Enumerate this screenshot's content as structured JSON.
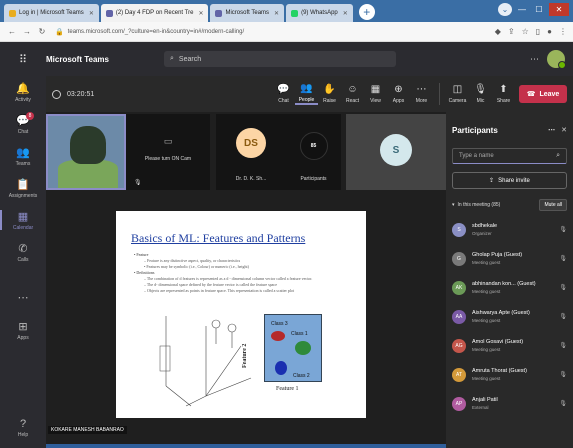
{
  "browser": {
    "tabs": [
      {
        "title": "Log in | Microsoft Teams",
        "color": "#e8ad20",
        "active": false
      },
      {
        "title": "(2) Day 4 FDP on Recent Tre",
        "color": "#6264a7",
        "active": true
      },
      {
        "title": "Microsoft Teams",
        "color": "#6264a7",
        "active": false
      },
      {
        "title": "(9) WhatsApp",
        "color": "#25d366",
        "active": false
      }
    ],
    "url": "teams.microsoft.com/_?culture=en-in&country=in#/modern-calling/"
  },
  "teams": {
    "app_name": "Microsoft Teams",
    "search_placeholder": "Search"
  },
  "rail": [
    {
      "label": "Activity",
      "icon": "bell-icon",
      "glyph": "🔔"
    },
    {
      "label": "Chat",
      "icon": "chat-icon",
      "glyph": "💬",
      "badge": "8"
    },
    {
      "label": "Teams",
      "icon": "teams-icon",
      "glyph": "👥"
    },
    {
      "label": "Assignments",
      "icon": "assignments-icon",
      "glyph": "📋"
    },
    {
      "label": "Calendar",
      "icon": "calendar-icon",
      "glyph": "▦",
      "active": true
    },
    {
      "label": "Calls",
      "icon": "phone-icon",
      "glyph": "✆"
    },
    {
      "label": "",
      "icon": "more-icon",
      "glyph": "⋯"
    },
    {
      "label": "Apps",
      "icon": "apps-icon",
      "glyph": "⊞"
    },
    {
      "label": "Help",
      "icon": "help-icon",
      "glyph": "?"
    }
  ],
  "meeting": {
    "timer": "03:20:51",
    "tools": [
      {
        "label": "Chat",
        "glyph": "💬"
      },
      {
        "label": "People",
        "glyph": "👥",
        "active": true
      },
      {
        "label": "Raise",
        "glyph": "✋"
      },
      {
        "label": "React",
        "glyph": "☺"
      },
      {
        "label": "View",
        "glyph": "▦"
      },
      {
        "label": "Apps",
        "glyph": "⊕"
      },
      {
        "label": "More",
        "glyph": "⋯"
      }
    ],
    "device_tools": [
      {
        "label": "Camera",
        "glyph": "◫"
      },
      {
        "label": "Mic",
        "glyph": "🎙"
      },
      {
        "label": "Share",
        "glyph": "⬆"
      }
    ],
    "leave_label": "Leave"
  },
  "tiles": {
    "camera_off_text": "Please turn ON Cam",
    "ds_initials": "DS",
    "ds_name": "Dr. D. K. Sh...",
    "count_label": "85",
    "count_name": "Participants",
    "s_initials": "S"
  },
  "slide": {
    "title": "Basics of ML: Features and Patterns",
    "bullets": [
      {
        "text": "• Feature",
        "sub": false
      },
      {
        "text": "– Feature is any distinctive aspect, quality, or characteristics",
        "sub": true
      },
      {
        "text": "• Features may be symbolic (i.e., Colour) or numeric (i.e., height)",
        "sub": true
      },
      {
        "text": "• Definitions",
        "sub": false
      },
      {
        "text": "– The combination of d features is represented as a d - dimensional column vector called a feature vector.",
        "sub": true
      },
      {
        "text": "– The d- dimensional space defined by the feature vector is called the feature space",
        "sub": true
      },
      {
        "text": "– Objects are represented as points in feature space. This representation is called a scatter plot",
        "sub": true
      }
    ],
    "class3": "Class 3",
    "class1": "Class 1",
    "class2": "Class 2",
    "feature1": "Feature 1",
    "feature2": "Feature 2"
  },
  "presenter_name": "KOKARE MANESH BABANRAO",
  "participants": {
    "title": "Participants",
    "search_placeholder": "Type a name",
    "share_invite": "Share invite",
    "in_meeting": "In this meeting (85)",
    "mute_all": "Mute all",
    "list": [
      {
        "initials": "S",
        "name": "sbdhekale",
        "role": "Organizer",
        "color": "#8a8fc4"
      },
      {
        "initials": "G",
        "name": "Gholap Puja (Guest)",
        "role": "Meeting guest",
        "color": "#7a7a7a"
      },
      {
        "initials": "AK",
        "name": "abhinandan kon... (Guest)",
        "role": "Meeting guest",
        "color": "#6b9a57"
      },
      {
        "initials": "AA",
        "name": "Aishwarya Apte (Guest)",
        "role": "Meeting guest",
        "color": "#7a5aa6"
      },
      {
        "initials": "AG",
        "name": "Amol Gosavi (Guest)",
        "role": "Meeting guest",
        "color": "#c4564b"
      },
      {
        "initials": "AT",
        "name": "Amruta Thorat (Guest)",
        "role": "Meeting guest",
        "color": "#d49a3a"
      },
      {
        "initials": "AP",
        "name": "Anjali Patil",
        "role": "External",
        "color": "#b05ba0"
      }
    ]
  }
}
